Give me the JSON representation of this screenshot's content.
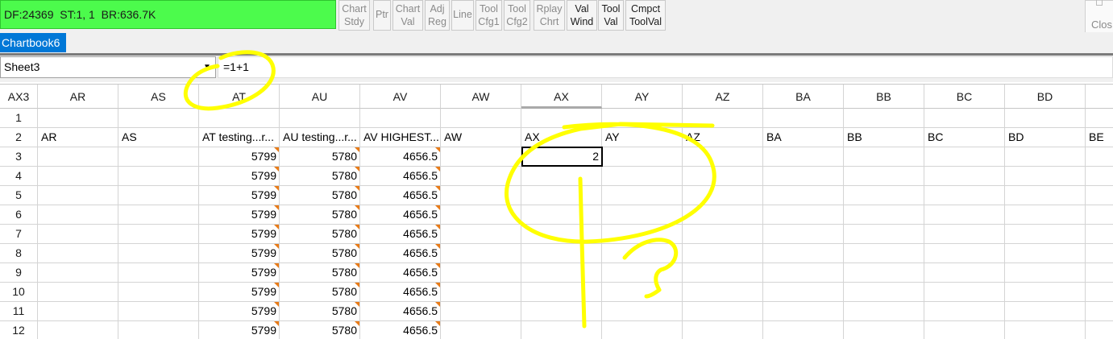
{
  "toolbar": {
    "status_text": "DF:24369  ST:1, 1  BR:636.7K",
    "buttons": [
      {
        "id": "chart-stdy",
        "l1": "Chart",
        "l2": "Stdy",
        "dark": false
      },
      {
        "id": "ptr",
        "l1": "Ptr",
        "l2": "",
        "dark": false
      },
      {
        "id": "chart-val",
        "l1": "Chart",
        "l2": "Val",
        "dark": false
      },
      {
        "id": "adj-reg",
        "l1": "Adj",
        "l2": "Reg",
        "dark": false
      },
      {
        "id": "line",
        "l1": "Line",
        "l2": "",
        "dark": false
      },
      {
        "id": "tool-cfg1",
        "l1": "Tool",
        "l2": "Cfg1",
        "dark": false
      },
      {
        "id": "tool-cfg2",
        "l1": "Tool",
        "l2": "Cfg2",
        "dark": false
      },
      {
        "id": "rplay-chrt",
        "l1": "Rplay",
        "l2": "Chrt",
        "dark": false
      },
      {
        "id": "val-wind",
        "l1": "Val",
        "l2": "Wind",
        "dark": true
      },
      {
        "id": "tool-val",
        "l1": "Tool",
        "l2": "Val",
        "dark": true
      },
      {
        "id": "cmpct-toolval",
        "l1": "Cmpct",
        "l2": "ToolVal",
        "dark": true
      }
    ],
    "close_label": "Clos"
  },
  "tabs": {
    "active": "Chartbook6"
  },
  "formula_bar": {
    "sheet": "Sheet3",
    "formula": "=1+1"
  },
  "grid": {
    "corner": "AX3",
    "columns": [
      "AR",
      "AS",
      "AT",
      "AU",
      "AV",
      "AW",
      "AX",
      "AY",
      "AZ",
      "BA",
      "BB",
      "BC",
      "BD"
    ],
    "rows": [
      "1",
      "2",
      "3",
      "4",
      "5",
      "6",
      "7",
      "8",
      "9",
      "10",
      "11",
      "12"
    ],
    "row2": [
      "AR",
      "AS",
      "AT testing...r...",
      "AU testing...r...",
      "AV HIGHEST...",
      "AW",
      "AX",
      "AY",
      "AZ",
      "BA",
      "BB",
      "BC",
      "BD",
      "BE"
    ],
    "at_value": "5799",
    "au_value": "5780",
    "av_value": "4656.5",
    "selected_value": "2",
    "flag_color": "#e87b18"
  },
  "annotation": {
    "color": "#ffff00",
    "shapes": [
      "circle-formula",
      "circle-cell",
      "question-mark"
    ]
  }
}
